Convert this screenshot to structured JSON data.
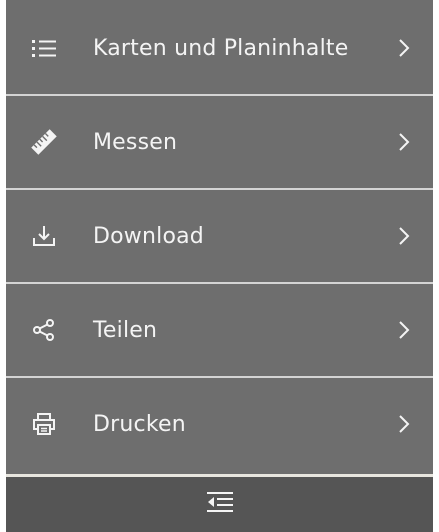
{
  "menu": {
    "items": [
      {
        "label": "Karten und Planinhalte",
        "icon": "list-icon"
      },
      {
        "label": "Messen",
        "icon": "ruler-icon"
      },
      {
        "label": "Download",
        "icon": "download-icon"
      },
      {
        "label": "Teilen",
        "icon": "share-icon"
      },
      {
        "label": "Drucken",
        "icon": "printer-icon"
      }
    ],
    "chevron_icon": "chevron-right-icon"
  },
  "footer": {
    "collapse_icon": "collapse-menu-icon"
  },
  "colors": {
    "panel_background": "#6e6e6e",
    "footer_background": "#555555",
    "divider": "#d4d4d4",
    "text": "#f4f4f4"
  }
}
